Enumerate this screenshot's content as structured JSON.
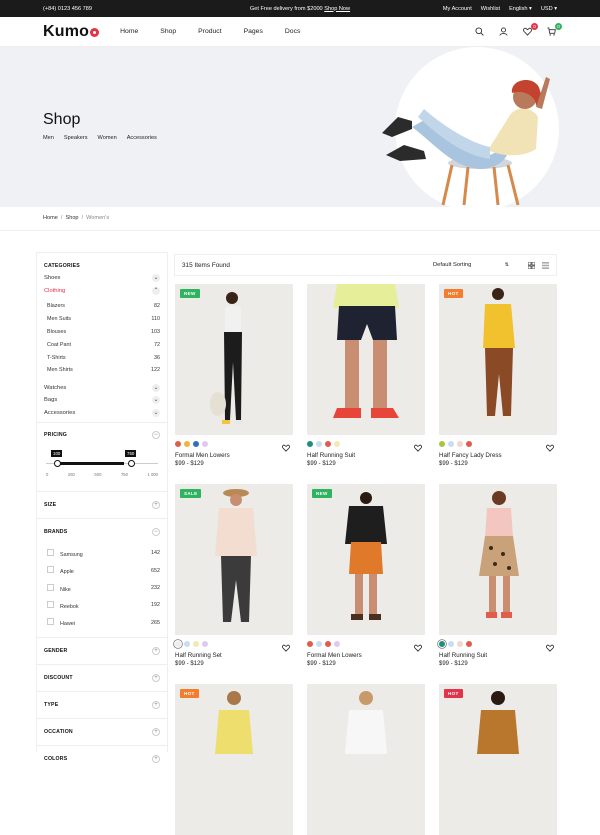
{
  "topbar": {
    "phone": "(+84) 0123 456 789",
    "promo_text": "Get Free delivery from $2000",
    "promo_link": "Shop Now",
    "account": "My Account",
    "wishlist": "Wishlist",
    "language": "English",
    "currency": "USD"
  },
  "header": {
    "logo": "Kumo",
    "nav": [
      "Home",
      "Shop",
      "Product",
      "Pages",
      "Docs"
    ],
    "wishlist_count": "0",
    "cart_count": "0",
    "colors": {
      "wishlist_badge": "#e2334a",
      "cart_badge": "#2fb35f"
    }
  },
  "hero": {
    "title": "Shop",
    "categories": [
      "Men",
      "Speakers",
      "Women",
      "Accessories"
    ]
  },
  "breadcrumb": [
    "Home",
    "Shop",
    "Women's"
  ],
  "sidebar": {
    "categories": {
      "title": "CATEGORIES",
      "items": [
        {
          "label": "Shoes"
        },
        {
          "label": "Clothing",
          "active": true
        }
      ],
      "sub_items": [
        {
          "label": "Blazers",
          "count": "82"
        },
        {
          "label": "Men Suits",
          "count": "110"
        },
        {
          "label": "Blouses",
          "count": "103"
        },
        {
          "label": "Coat Pant",
          "count": "72"
        },
        {
          "label": "T-Shirts",
          "count": "36"
        },
        {
          "label": "Men Shirts",
          "count": "122"
        }
      ],
      "more_items": [
        {
          "label": "Watches"
        },
        {
          "label": "Bags"
        },
        {
          "label": "Accessories"
        }
      ]
    },
    "pricing": {
      "title": "PRICING",
      "min_label": "100",
      "max_label": "750",
      "min_value": 100,
      "max_value": 750,
      "ticks": [
        "0",
        "250",
        "500",
        "750",
        "1 000"
      ]
    },
    "size": {
      "title": "SIZE"
    },
    "brands": {
      "title": "BRANDS",
      "items": [
        {
          "label": "Samsung",
          "count": "142"
        },
        {
          "label": "Apple",
          "count": "652"
        },
        {
          "label": "Nike",
          "count": "232"
        },
        {
          "label": "Reebok",
          "count": "192"
        },
        {
          "label": "Hawei",
          "count": "265"
        }
      ]
    },
    "collapsed_sections": [
      "GENDER",
      "DISCOUNT",
      "TYPE",
      "OCCATION",
      "COLORS"
    ]
  },
  "toolbar": {
    "items_found": "315 Items Found",
    "sort": "Default Sorting"
  },
  "colors": {
    "new_tag": "#2fb35f",
    "sale_tag": "#2fb35f",
    "hot_tag": "#f47c2d",
    "hot_tag_pink": "#e2334a",
    "clothing_active": "#e2334a"
  },
  "products": [
    {
      "name": "Formal Men Lowers",
      "price": "$99 - $129",
      "tag": "NEW",
      "swatches": [
        "#e05c4b",
        "#f0b43c",
        "#2f6fc0",
        "#dfc9ec"
      ]
    },
    {
      "name": "Half Running Suit",
      "price": "$99 - $129",
      "tag": "",
      "swatches": [
        "#1e8f7d",
        "#c8ddf4",
        "#e05c4b",
        "#f2e9b5"
      ]
    },
    {
      "name": "Half Fancy Lady Dress",
      "price": "$99 - $129",
      "tag": "HOT",
      "swatches": [
        "#a6c73c",
        "#c8ddf4",
        "#f2d6cf",
        "#e05c4b"
      ]
    },
    {
      "name": "Half Running Set",
      "price": "$99 - $129",
      "tag": "SALE",
      "swatches": [
        "#eeeeee",
        "#c8ddf4",
        "#f2e9b5",
        "#dfc9ec"
      ]
    },
    {
      "name": "Formal Men Lowers",
      "price": "$99 - $129",
      "tag": "NEW",
      "swatches": [
        "#e05c4b",
        "#c8ddf4",
        "#e05c4b",
        "#dfc9ec"
      ]
    },
    {
      "name": "Half Running Suit",
      "price": "$99 - $129",
      "tag": "",
      "swatches": [
        "#1e8f7d",
        "#c8ddf4",
        "#f2d6cf",
        "#e05c4b"
      ]
    },
    {
      "name": "",
      "price": "",
      "tag": "HOT",
      "swatches": []
    },
    {
      "name": "",
      "price": "",
      "tag": "",
      "swatches": []
    },
    {
      "name": "",
      "price": "",
      "tag": "HOT",
      "swatches": []
    }
  ]
}
